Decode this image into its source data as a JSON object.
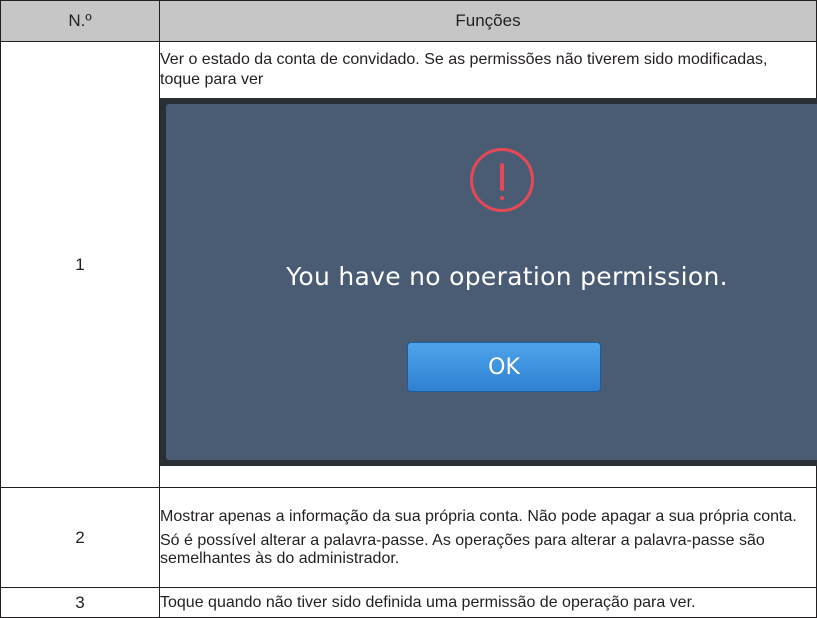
{
  "table": {
    "headers": {
      "number": "N.º",
      "functions": "Funções"
    },
    "rows": [
      {
        "number": "1",
        "text": "Ver o estado da conta de convidado. Se as permissões não tiverem sido modificadas, toque para ver",
        "dialog": {
          "icon": "warning-icon",
          "message": "You have no operation permission.",
          "button": "OK"
        }
      },
      {
        "number": "2",
        "paragraph1": "Mostrar apenas a informação da sua própria conta. Não pode apagar a sua própria conta.",
        "paragraph2": "Só é possível alterar a palavra-passe. As operações para alterar a palavra-passe são semelhantes às do administrador."
      },
      {
        "number": "3",
        "text": "Toque quando não tiver sido definida uma permissão de operação para ver."
      }
    ]
  },
  "colors": {
    "header_bg": "#c6c6c6",
    "dialog_bg": "#4a5c73",
    "dialog_frame": "#2a2f35",
    "warning": "#e74856",
    "button": "#3a8edc"
  }
}
